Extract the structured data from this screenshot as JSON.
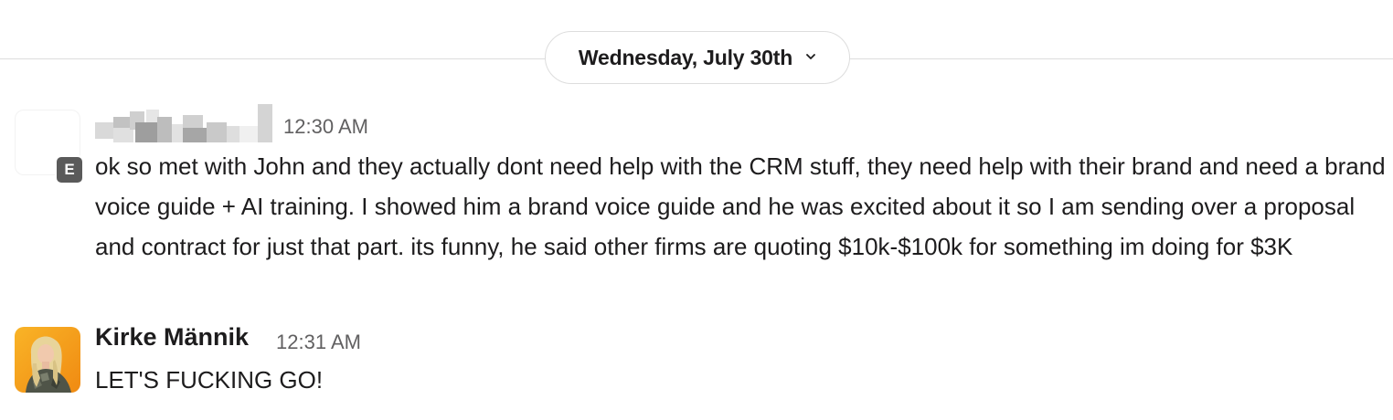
{
  "date_divider": {
    "label": "Wednesday, July 30th",
    "icon": "chevron-down-icon"
  },
  "messages": [
    {
      "sender": "",
      "sender_redacted": true,
      "badge": "E",
      "time": "12:30 AM",
      "text": "ok so met with John and they actually dont need help with the CRM stuff, they need help with their brand and need a brand voice guide + AI training. I showed him a brand voice guide and he was excited about it so I am sending over a proposal and contract for just that part. its funny, he said other firms are quoting $10k-$100k for something im doing for $3K"
    },
    {
      "sender": "Kirke Männik",
      "time": "12:31 AM",
      "text": "LET'S FUCKING GO!"
    }
  ],
  "colors": {
    "text": "#1d1c1d",
    "timestamp": "#616061",
    "divider": "#dddddd",
    "badge": "#5a5a5a",
    "avatar_bg": "#f7a21b"
  }
}
